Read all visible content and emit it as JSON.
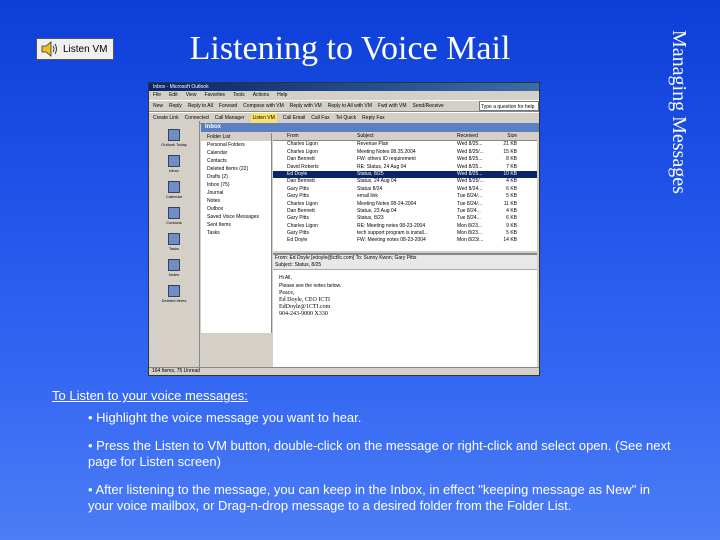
{
  "listen_button": {
    "label": "Listen VM"
  },
  "title": "Listening to Voice Mail",
  "side_title": "Managing Messages",
  "outlook": {
    "window_title": "Inbox - Microsoft Outlook",
    "menu": [
      "File",
      "Edit",
      "View",
      "Favorites",
      "Tools",
      "Actions",
      "Help"
    ],
    "toolbar": [
      "New",
      "Reply",
      "Reply to All",
      "Forward",
      "Compose with VM",
      "Reply with VM",
      "Reply to All with VM",
      "Fwd with VM",
      "Send/Receive"
    ],
    "toolbar2": [
      "Create Link",
      "Connected",
      "Call Manager",
      "Listen VM",
      "Call Email",
      "Call Fax",
      "Tel Quick",
      "Reply Fax"
    ],
    "ask_box": "Type a question for help",
    "folder_pane_title": "Folder List",
    "inbox_label": "Inbox",
    "shortcuts": [
      "Outlook Today",
      "Inbox",
      "Calendar",
      "Contacts",
      "Tasks",
      "Notes",
      "Deleted Items"
    ],
    "folders": [
      "Personal Folders",
      "Calendar",
      "Contacts",
      "Deleted Items (22)",
      "Drafts (2)",
      "Inbox (75)",
      "Journal",
      "Notes",
      "Outbox",
      "Saved Voice Messages",
      "Sent Items",
      "Tasks"
    ],
    "list_headers": {
      "from": "From",
      "subject": "Subject",
      "received": "Received",
      "size": "Size"
    },
    "messages": [
      {
        "from": "Charles Ligon",
        "subject": "Revenue Plan",
        "received": "Wed 8/25...",
        "size": "21 KB"
      },
      {
        "from": "Charles Ligon",
        "subject": "Meeting Notes 08.25.2004",
        "received": "Wed 8/25/...",
        "size": "15 KB"
      },
      {
        "from": "Dan Bennett",
        "subject": "FW: others ID requirement",
        "received": "Wed 8/25...",
        "size": "8 KB"
      },
      {
        "from": "David Roberts",
        "subject": "RE: Status, 24 Aug 04",
        "received": "Wed 8/25...",
        "size": "7 KB"
      },
      {
        "from": "Ed Doyle",
        "subject": "Status, 8/25",
        "received": "Wed 8/25...",
        "size": "10 KB"
      },
      {
        "from": "Dan Bennett",
        "subject": "Status, 24 Aug 04",
        "received": "Wed 8/25/...",
        "size": "4 KB"
      },
      {
        "from": "Gary Pitts",
        "subject": "Status 8/24",
        "received": "Wed 8/24...",
        "size": "6 KB"
      },
      {
        "from": "Gary Pitts",
        "subject": "email link",
        "received": "Tue 8/24/...",
        "size": "5 KB"
      },
      {
        "from": "Charles Ligon",
        "subject": "Meeting Notes 08-24-2004",
        "received": "Tue 8/24/...",
        "size": "11 KB"
      },
      {
        "from": "Dan Bennett",
        "subject": "Status, 23 Aug 04",
        "received": "Tue 8/24...",
        "size": "4 KB"
      },
      {
        "from": "Gary Pitts",
        "subject": "Status, 8/23",
        "received": "Tue 8/24...",
        "size": "6 KB"
      },
      {
        "from": "Charles Ligon",
        "subject": "RE: Meeting notes 08-23-2004",
        "received": "Mon 8/23...",
        "size": "9 KB"
      },
      {
        "from": "Gary Pitts",
        "subject": "tech support program is install...",
        "received": "Mon 8/23...",
        "size": "5 KB"
      },
      {
        "from": "Ed Doyle",
        "subject": "FW: Meeting notes 08-23-2004",
        "received": "Mon 8/23/...",
        "size": "14 KB"
      }
    ],
    "preview": {
      "from_line": "From: Ed Doyle [edoyle@ictllc.com]    To: Sunny Kwon; Gary Pitts",
      "subject_line": "Subject: Status, 8/25",
      "greeting": "Hi All,",
      "body": "Please see the notes below.",
      "sig_1": "Peace,",
      "sig_2": "Ed Doyle, CEO ICTI",
      "sig_3": "EdDoyle@1CTI.com",
      "sig_4": "904-243-9000 X330"
    },
    "status": "164 Items, 75 Unread"
  },
  "instructions": {
    "heading": "To Listen to your voice messages:",
    "bullet_1": "• Highlight the voice message you want to hear.",
    "bullet_2": "• Press the Listen to VM button, double-click on the message or right-click and select open. (See next page for Listen screen)",
    "bullet_3": "• After listening to the message, you can keep in the Inbox, in effect \"keeping message as New\" in your voice mailbox, or Drag-n-drop message to a desired folder from the Folder List."
  }
}
